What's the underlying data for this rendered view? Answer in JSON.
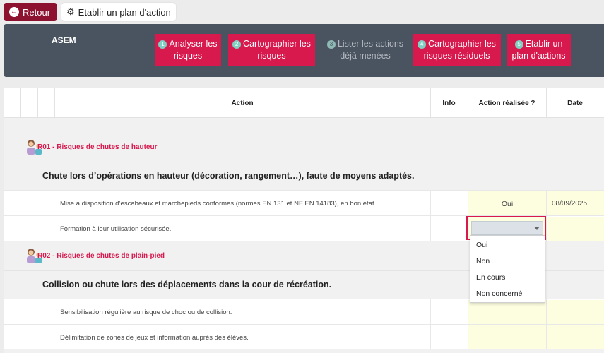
{
  "topbar": {
    "back_label": "Retour",
    "plan_label": "Etablir un plan d'action"
  },
  "header": {
    "org": "ASEM",
    "steps": [
      {
        "num": "1",
        "line1": "Analyser les",
        "line2": "risques"
      },
      {
        "num": "2",
        "line1": "Cartographier les",
        "line2": "risques"
      },
      {
        "num": "3",
        "line1": "Lister les actions",
        "line2": "déjà menées"
      },
      {
        "num": "4",
        "line1": "Cartographier les",
        "line2": "risques résiduels"
      },
      {
        "num": "5",
        "line1": "Etablir un",
        "line2": "plan d'actions"
      }
    ]
  },
  "table": {
    "headers": {
      "action": "Action",
      "info": "Info",
      "done": "Action réalisée ?",
      "date": "Date"
    },
    "risks": [
      {
        "title": "R01 - Risques de chutes de hauteur",
        "situation": "Chute lors d’opérations en hauteur (décoration, rangement…), faute de moyens adaptés.",
        "actions": [
          {
            "text": "Mise à disposition d’escabeaux et marchepieds conformes (normes EN 131 et NF EN 14183), en bon état.",
            "done": "Oui",
            "date": "08/09/2025"
          },
          {
            "text": "Formation à leur utilisation sécurisée.",
            "done": "",
            "date": ""
          }
        ]
      },
      {
        "title": "R02 - Risques de chutes de plain-pied",
        "situation": "Collision ou chute lors des déplacements dans la cour de récréation.",
        "actions": [
          {
            "text": "Sensibilisation régulière au risque de choc ou de collision.",
            "done": "",
            "date": ""
          },
          {
            "text": "Délimitation de zones de jeux et information auprès des élèves.",
            "done": "",
            "date": ""
          }
        ]
      }
    ]
  },
  "dropdown": {
    "options": [
      "Oui",
      "Non",
      "En cours",
      "Non concerné"
    ]
  },
  "colors": {
    "accent": "#d8194e",
    "back_button": "#8c1230",
    "header_bg": "#4a5461",
    "highlight_cell": "#fdfde0"
  }
}
